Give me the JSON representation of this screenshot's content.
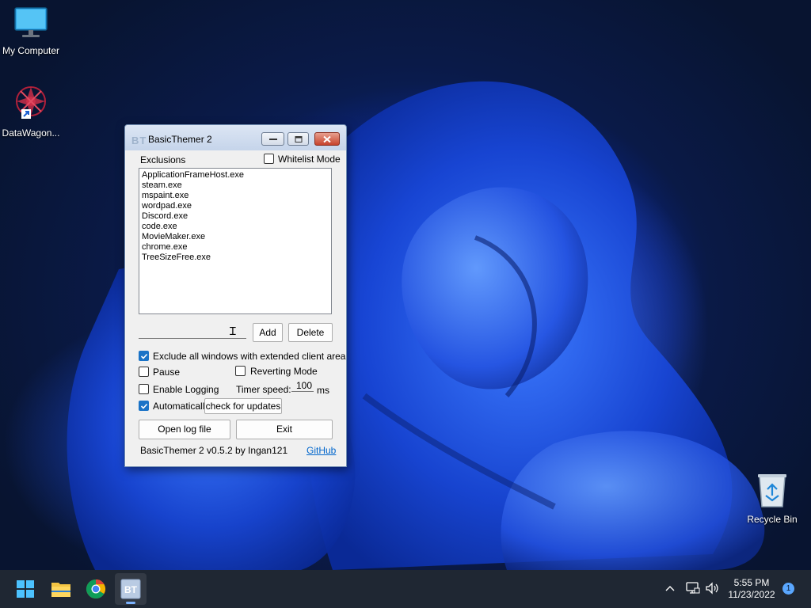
{
  "desktop": {
    "icons": [
      {
        "label": "My Computer"
      },
      {
        "label": "DataWagon..."
      },
      {
        "label": "Recycle Bin"
      }
    ]
  },
  "window": {
    "title": "BasicThemer 2",
    "icon_text": "BT",
    "exclusions_label": "Exclusions",
    "whitelist_mode_label": "Whitelist Mode",
    "whitelist_mode_checked": false,
    "exclusions": [
      "ApplicationFrameHost.exe",
      "steam.exe",
      "mspaint.exe",
      "wordpad.exe",
      "Discord.exe",
      "code.exe",
      "MovieMaker.exe",
      "chrome.exe",
      "TreeSizeFree.exe"
    ],
    "new_entry_value": "",
    "add_label": "Add",
    "delete_label": "Delete",
    "exclude_extended_label": "Exclude all windows with extended client area",
    "exclude_extended_checked": true,
    "pause_label": "Pause",
    "pause_checked": false,
    "reverting_mode_label": "Reverting Mode",
    "reverting_mode_checked": false,
    "enable_logging_label": "Enable Logging",
    "enable_logging_checked": false,
    "timer_speed_label": "Timer speed:",
    "timer_speed_value": "100",
    "timer_unit": "ms",
    "automatically_label": "Automatically",
    "automatically_checked": true,
    "check_updates_label": "check for updates",
    "open_log_label": "Open log file",
    "exit_label": "Exit",
    "version_text": "BasicThemer 2 v0.5.2 by Ingan121",
    "github_label": "GitHub"
  },
  "taskbar": {
    "time": "5:55 PM",
    "date": "11/23/2022",
    "notification_count": "1",
    "apps": [
      "start-icon",
      "file-explorer-icon",
      "chrome-icon",
      "basicthemer-icon"
    ],
    "basicthemer_icon_text": "BT"
  },
  "colors": {
    "accent": "#1a73c7",
    "taskbar": "#1f2733",
    "link": "#0066cc"
  }
}
